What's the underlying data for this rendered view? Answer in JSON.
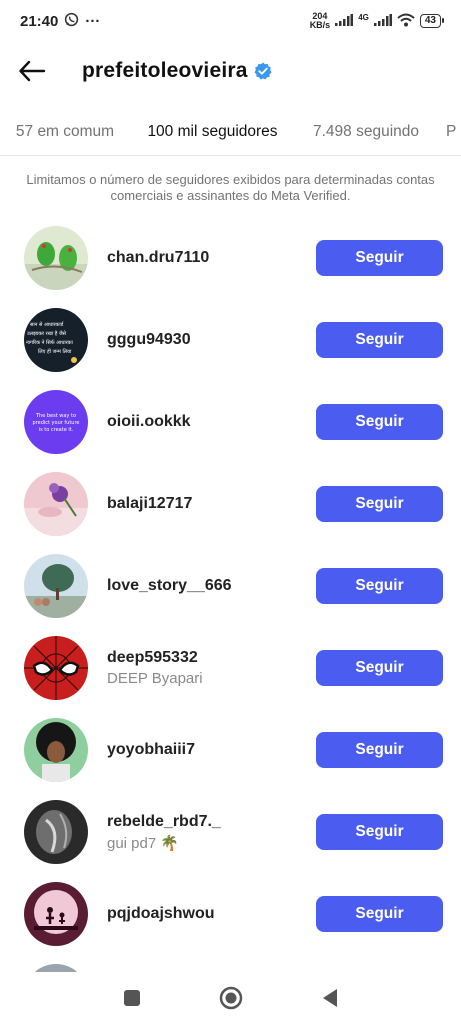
{
  "status_bar": {
    "time": "21:40",
    "extra": "···",
    "net_speed_value": "204",
    "net_speed_unit": "KB/s",
    "network_type": "4G",
    "battery": "43"
  },
  "header": {
    "title": "prefeitoleovieira",
    "verified_icon": "verified-badge-icon"
  },
  "tabs": [
    {
      "label": "57 em comum",
      "active": false
    },
    {
      "label": "100 mil seguidores",
      "active": true
    },
    {
      "label": "7.498 seguindo",
      "active": false
    },
    {
      "label": "P",
      "active": false
    }
  ],
  "notice": "Limitamos o número de seguidores exibidos para determinadas contas comerciais e assinantes do Meta Verified.",
  "follow_label": "Seguir",
  "accent_color": "#4a5df0",
  "followers": [
    {
      "username": "chan.dru7110",
      "fullname": ""
    },
    {
      "username": "gggu94930",
      "fullname": ""
    },
    {
      "username": "oioii.ookkk",
      "fullname": ""
    },
    {
      "username": "balaji12717",
      "fullname": ""
    },
    {
      "username": "love_story__666",
      "fullname": ""
    },
    {
      "username": "deep595332",
      "fullname": "DEEP Byapari"
    },
    {
      "username": "yoyobhaiii7",
      "fullname": ""
    },
    {
      "username": "rebelde_rbd7._",
      "fullname": "gui pd7 🌴"
    },
    {
      "username": "pqjdoajshwou",
      "fullname": ""
    }
  ],
  "avatar_texts": {
    "gggu": [
      "सान से आधारकार्ड",
      "उलझाकर रखा है जैसे",
      "नागरिक ने सिर्फ आधारका",
      "लिए ही जन्म लिया"
    ],
    "oioii": [
      "The best way to",
      "predict your future",
      "is to create it."
    ]
  }
}
